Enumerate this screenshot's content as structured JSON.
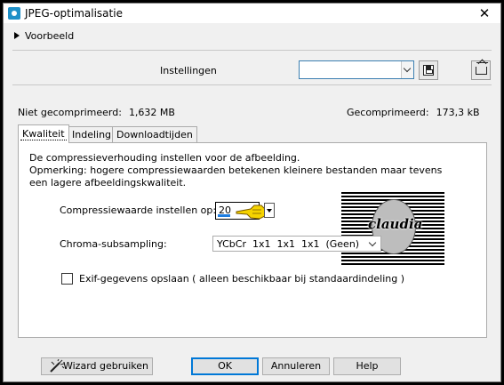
{
  "window": {
    "title": "JPEG-optimalisatie",
    "close_glyph": "✕"
  },
  "preview": {
    "label": "Voorbeeld"
  },
  "settings": {
    "label": "Instellingen",
    "combo_value": ""
  },
  "stats": {
    "uncompressed_label": "Niet gecomprimeerd:",
    "uncompressed_value": "1,632 MB",
    "compressed_label": "Gecomprimeerd:",
    "compressed_value": "173,3 kB"
  },
  "tabs": [
    {
      "label": "Kwaliteit",
      "active": true
    },
    {
      "label": "Indeling",
      "active": false
    },
    {
      "label": "Downloadtijden",
      "active": false
    }
  ],
  "quality": {
    "description": "De compressieverhouding instellen voor de afbeelding.",
    "note_line1": "Opmerking:  hogere compressiewaarden betekenen kleinere bestanden maar tevens",
    "note_line2": "een lagere afbeeldingskwaliteit.",
    "compression_label": "Compressiewaarde instellen op:",
    "compression_value": "20",
    "chroma_label": "Chroma-subsampling:",
    "chroma_value": "YCbCr  1x1  1x1  1x1  (Geen)",
    "exif_label": "Exif-gegevens opslaan ( alleen beschikbaar bij standaardindeling )",
    "exif_checked": false
  },
  "logo_text": "claudia",
  "buttons": {
    "wizard": "Wizard gebruiken",
    "ok": "OK",
    "cancel": "Annuleren",
    "help": "Help"
  },
  "icons": {
    "app": "jpeg-app-icon",
    "expand": "triangle-right-icon",
    "save": "floppy-disk-icon",
    "load": "load-preset-icon",
    "hand": "pointing-hand-icon",
    "wand": "magic-wand-icon"
  },
  "colors": {
    "accent": "#0078d7",
    "window_bg": "#f0f0f0",
    "frame": "#000000"
  }
}
